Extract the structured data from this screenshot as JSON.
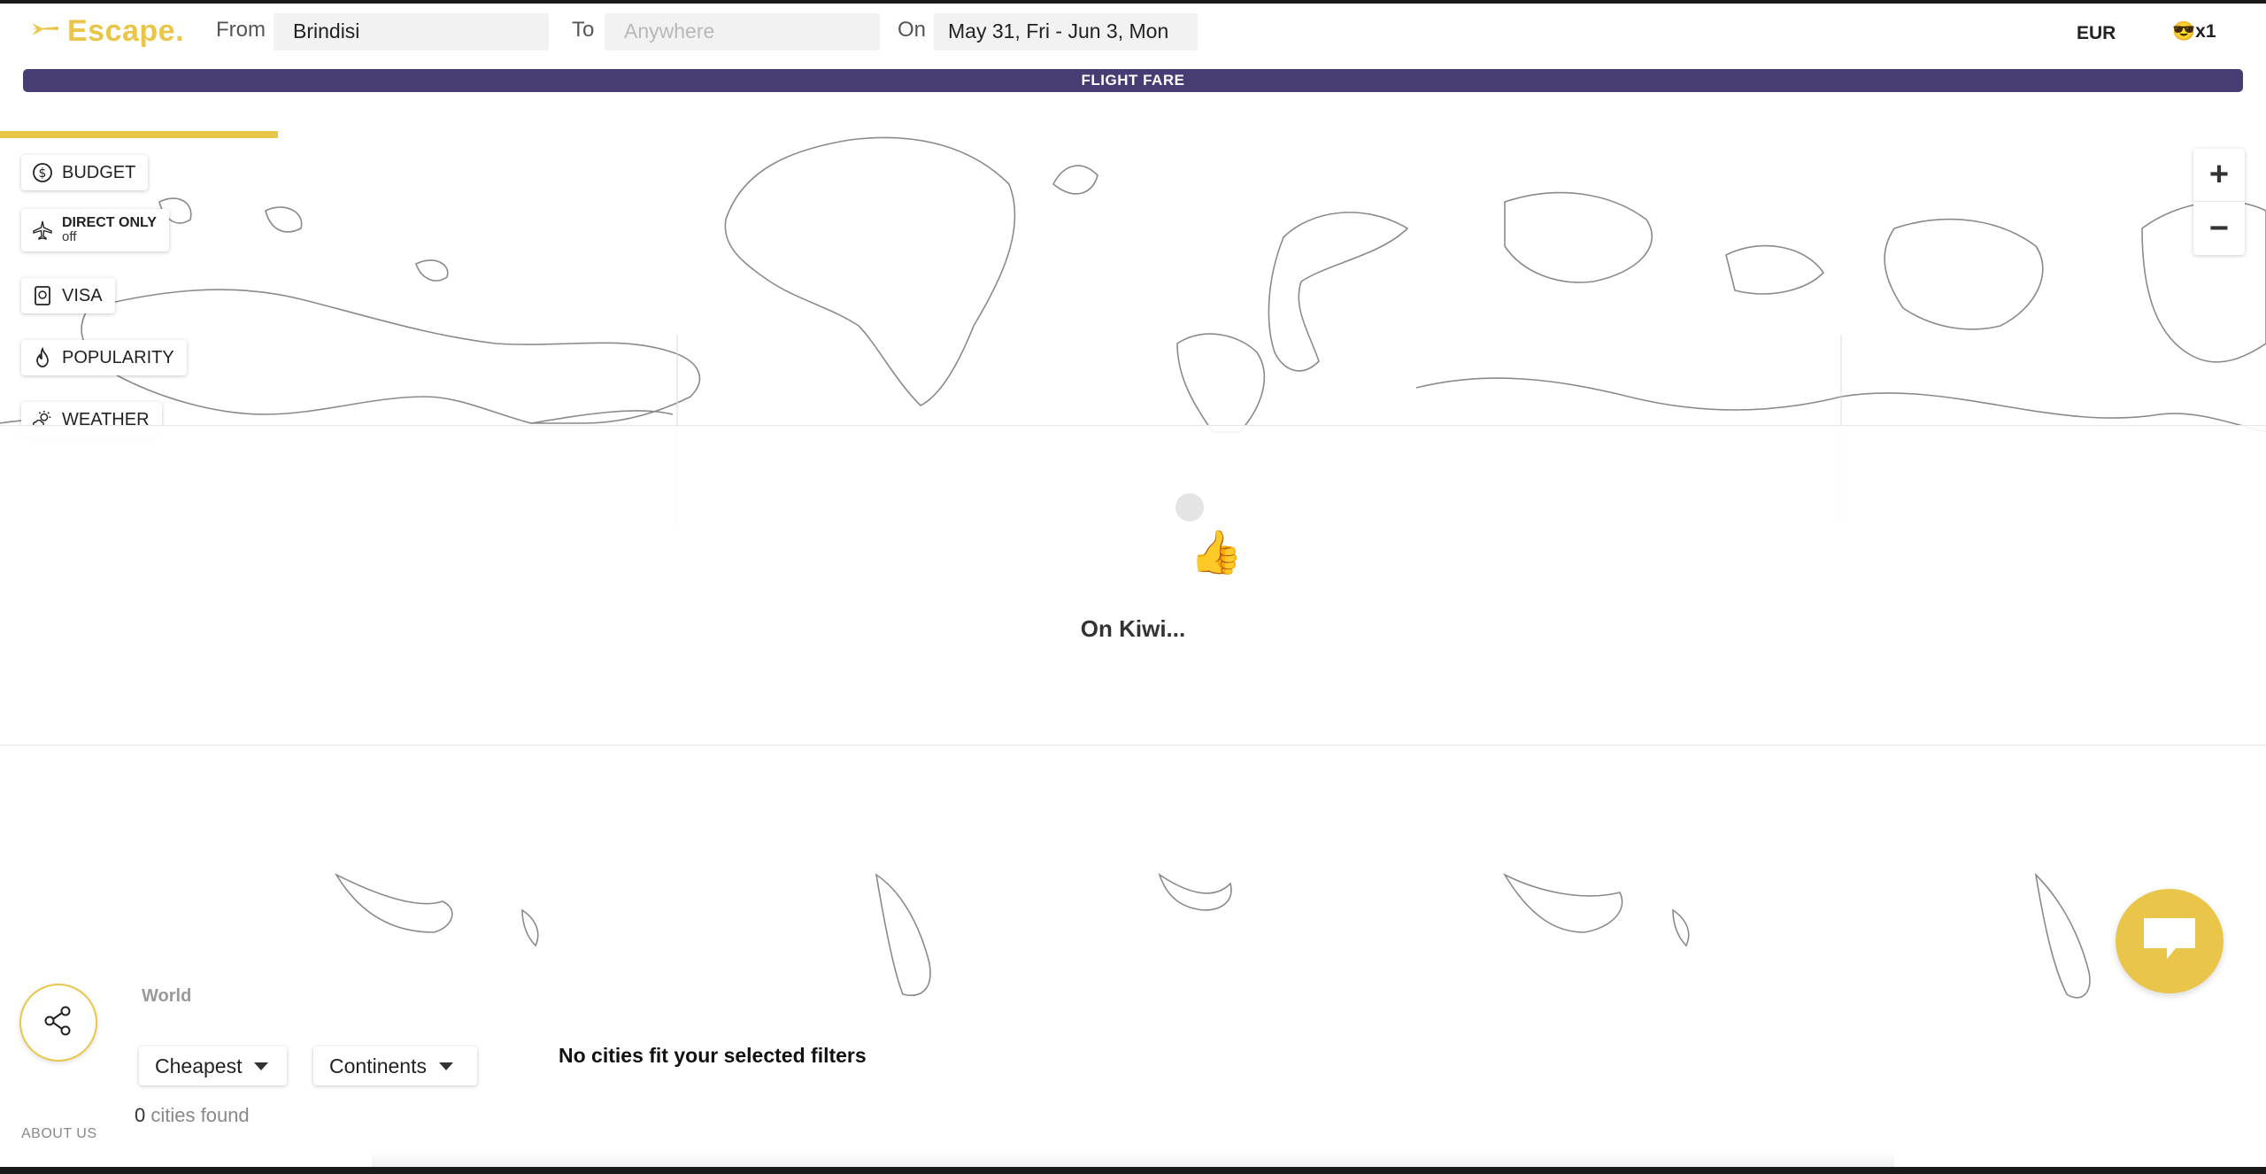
{
  "header": {
    "brand": "Escape.",
    "from_label": "From",
    "from_value": "Brindisi",
    "to_label": "To",
    "to_placeholder": "Anywhere",
    "on_label": "On",
    "dates_value": "May 31, Fri - Jun 3, Mon",
    "currency": "EUR",
    "travellers": "😎x1",
    "fare_bar": "FLIGHT FARE"
  },
  "filters": {
    "budget": "BUDGET",
    "direct_title": "DIRECT ONLY",
    "direct_state": "off",
    "visa": "VISA",
    "popularity": "POPULARITY",
    "weather": "WEATHER"
  },
  "map": {
    "zoom_in": "+",
    "zoom_out": "−",
    "loading_text": "On Kiwi...",
    "loading_emoji": "👍"
  },
  "panel": {
    "region": "World",
    "sort": "Cheapest",
    "group": "Continents",
    "count": "0",
    "count_label": "cities found",
    "empty_message": "No cities fit your selected filters",
    "about": "ABOUT US"
  },
  "colors": {
    "accent": "#e9c54a",
    "fare_bar": "#483d73"
  }
}
